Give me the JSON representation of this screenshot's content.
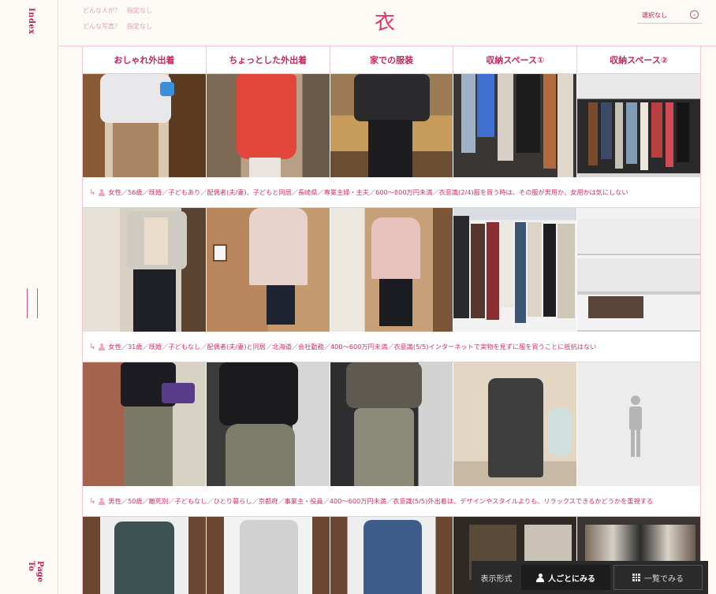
{
  "rail": {
    "index_label": "Index",
    "pagetop_label": "Page To"
  },
  "header": {
    "filter_lines": [
      "どんな人が？　指定なし",
      "どんな写真？　指定なし"
    ],
    "title_kanji": "衣",
    "select": {
      "label": "選択なし"
    }
  },
  "categories": [
    "おしゃれ外出着",
    "ちょっとした外出着",
    "家での服装",
    "収納スペース①",
    "収納スペース②"
  ],
  "rows": [
    {
      "caption": "女性／56歳／既婚／子どもあり／配偶者(夫/妻)、子どもと同居／長崎県／専業主婦・主夫／600〜800万円未満／衣意識(2/4)服を買う時は、その服が男用か、女用かは気にしない"
    },
    {
      "caption": "女性／31歳／既婚／子どもなし／配偶者(夫/妻)と同居／北海道／会社勤務／400〜600万円未満／衣意識(5/5)インターネットで実物を見ずに服を買うことに抵抗はない"
    },
    {
      "caption": "男性／50歳／離死別／子どもなし／ひとり暮らし／京都府／事業主・役員／400〜600万円未満／衣意識(5/5)外出着は、デザインやスタイルよりも、リラックスできるかどうかを重視する"
    }
  ],
  "viewbar": {
    "label": "表示形式",
    "by_person": "人ごとにみる",
    "list": "一覧でみる"
  },
  "colors": {
    "accent": "#c2275e",
    "border": "#f0c9d5",
    "bg": "#fdf9f5"
  }
}
